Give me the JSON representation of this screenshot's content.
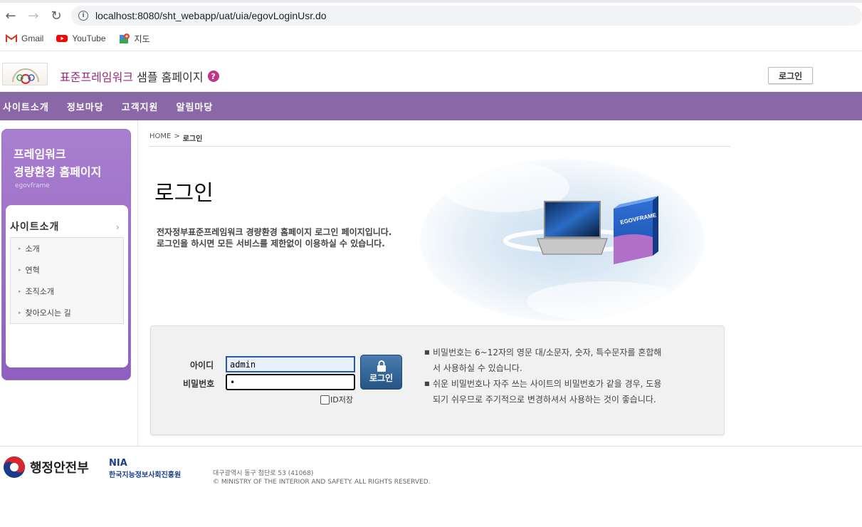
{
  "browser": {
    "url": "localhost:8080/sht_webapp/uat/uia/egovLoginUsr.do",
    "bookmarks": [
      {
        "label": "Gmail",
        "icon": "gmail-icon"
      },
      {
        "label": "YouTube",
        "icon": "youtube-icon"
      },
      {
        "label": "지도",
        "icon": "maps-icon"
      }
    ]
  },
  "header": {
    "title_highlight": "표준프레임워크",
    "title_rest": " 샘플 홈페이지",
    "login_button": "로그인"
  },
  "gnb": [
    "사이트소개",
    "정보마당",
    "고객지원",
    "알림마당"
  ],
  "sidebar": {
    "title_line1": "프레임워크",
    "title_line2": "경량환경 홈페이지",
    "subtitle": "egovframe",
    "menu_title": "사이트소개",
    "items": [
      "소개",
      "연혁",
      "조직소개",
      "찾아오시는 길"
    ]
  },
  "breadcrumb": {
    "home": "HOME",
    "sep": ">",
    "current": "로그인"
  },
  "content": {
    "title": "로그인",
    "desc_line1": "전자정부표준프레임워크 경량환경 홈페이지 로그인 페이지입니다.",
    "desc_line2": "로그인을 하시면 모든 서비스를 제한없이 이용하실 수 있습니다.",
    "hero_box_label": "EGOVFRAME"
  },
  "login_form": {
    "id_label": "아이디",
    "pw_label": "비밀번호",
    "id_value": "admin",
    "pw_value": "•",
    "button": "로그인",
    "save_id": "ID저장",
    "notes": [
      [
        "비밀번호는 6~12자의 영문 대/소문자, 숫자, 특수문자를 혼합해",
        "서 사용하실 수 있습니다."
      ],
      [
        "쉬운 비밀번호나 자주 쓰는 사이트의 비밀번호가 같을 경우, 도용",
        "되기 쉬우므로 주기적으로 변경하셔서 사용하는 것이 좋습니다."
      ]
    ]
  },
  "footer": {
    "ministry": "행정안전부",
    "nia_big": "NIA",
    "nia_small": "한국지능정보사회진흥원",
    "address": "대구광역시 동구 첨단로 53 (41068)",
    "copyright": "© MINISTRY OF THE INTERIOR AND SAFETY. ALL RIGHTS RESERVED."
  }
}
